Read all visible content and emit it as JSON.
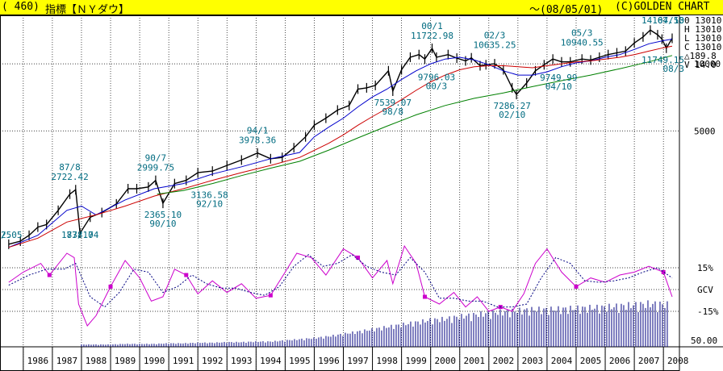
{
  "header": {
    "code": "( 460)",
    "title": "指標【ＮＹダウ】",
    "date_range": "～(08/05/01)",
    "copyright": "(C)GOLDEN CHART"
  },
  "colors": {
    "price": "#000000",
    "ma_short": "#0000cc",
    "ma_mid": "#cc0000",
    "ma_long": "#008000",
    "oscillator": "#cc00cc",
    "oscillator_signal": "#000080",
    "annotation": "#006b80",
    "grid": "#000000",
    "header_bg": "#ffff00"
  },
  "ohlc_panel": {
    "O": "0 13010",
    "H": "H 13010",
    "L": "L 13010",
    "C": "C 13010",
    "change": "△189.8",
    "V": "V  14.0"
  },
  "chart_data": {
    "type": "line",
    "title": "指標【ＮＹダウ】",
    "x_axis": {
      "tick_labels": [
        "1986",
        "1987",
        "1988",
        "1989",
        "1990",
        "1991",
        "1992",
        "1993",
        "1994",
        "1995",
        "1996",
        "1997",
        "1998",
        "1999",
        "2000",
        "2001",
        "2002",
        "2003",
        "2004",
        "2005",
        "2006",
        "2007",
        "2008"
      ]
    },
    "y_axis_price": {
      "scale": "log",
      "tick_labels": [
        "10000",
        "5000"
      ],
      "ticks": [
        10000,
        5000
      ],
      "range": [
        1600,
        16500
      ]
    },
    "y_axis_oscillator": {
      "tick_labels": [
        "15%",
        "GCV",
        "-15%"
      ],
      "ticks": [
        15,
        0,
        -15
      ]
    },
    "y_axis_volume": {
      "tick_labels": [
        "50.00"
      ]
    },
    "series": [
      {
        "key": "price",
        "x": [
          1985.5,
          1985.9,
          1986.2,
          1986.5,
          1986.8,
          1987.2,
          1987.6,
          1987.8,
          1987.95,
          1988.3,
          1988.7,
          1989.2,
          1989.6,
          1989.9,
          1990.3,
          1990.55,
          1990.8,
          1991.2,
          1991.6,
          1992.0,
          1992.5,
          1993.0,
          1993.5,
          1994.05,
          1994.5,
          1994.9,
          1995.3,
          1995.7,
          1996.0,
          1996.4,
          1996.8,
          1997.2,
          1997.5,
          1997.8,
          1998.1,
          1998.55,
          1998.7,
          1999.0,
          1999.3,
          1999.6,
          1999.8,
          2000.05,
          2000.2,
          2000.6,
          2000.9,
          2001.2,
          2001.4,
          2001.7,
          2001.9,
          2002.2,
          2002.5,
          2002.8,
          2002.95,
          2003.3,
          2003.6,
          2003.9,
          2004.2,
          2004.5,
          2004.8,
          2005.2,
          2005.5,
          2005.8,
          2006.1,
          2006.4,
          2006.7,
          2007.0,
          2007.3,
          2007.55,
          2007.8,
          2007.95,
          2008.1,
          2008.3
        ],
        "y": [
          1550,
          1600,
          1700,
          1850,
          1900,
          2200,
          2600,
          2722,
          1738,
          2050,
          2150,
          2350,
          2750,
          2750,
          2800,
          2999,
          2365,
          2900,
          3000,
          3250,
          3300,
          3500,
          3700,
          3978,
          3750,
          3800,
          4200,
          4700,
          5300,
          5700,
          6200,
          6500,
          7700,
          7800,
          8000,
          9300,
          7539,
          9400,
          10700,
          11000,
          10500,
          11722,
          10700,
          11000,
          10600,
          10300,
          10635,
          9800,
          9900,
          10000,
          9400,
          7800,
          7286,
          8200,
          9300,
          9900,
          10500,
          10200,
          10200,
          10500,
          10400,
          10700,
          11000,
          11200,
          11400,
          12400,
          13200,
          14164,
          13500,
          12900,
          11749,
          13010
        ]
      },
      {
        "key": "ma_short",
        "x": [
          1985.5,
          1986.5,
          1987.5,
          1988.0,
          1988.5,
          1989.5,
          1990.5,
          1991.5,
          1992.5,
          1993.5,
          1994.5,
          1995.5,
          1996.0,
          1996.5,
          1997.0,
          1997.5,
          1998.0,
          1998.5,
          1999.0,
          1999.5,
          2000.0,
          2000.5,
          2001.0,
          2001.5,
          2002.0,
          2002.5,
          2003.0,
          2003.5,
          2004.0,
          2004.5,
          2005.0,
          2005.5,
          2006.0,
          2006.5,
          2007.0,
          2007.5,
          2008.0,
          2008.3
        ],
        "y": [
          1500,
          1700,
          2200,
          2300,
          2100,
          2450,
          2750,
          2900,
          3200,
          3450,
          3750,
          4000,
          4700,
          5200,
          5700,
          6400,
          7100,
          7700,
          8500,
          9300,
          10000,
          10500,
          10700,
          10400,
          9900,
          9300,
          8900,
          8900,
          9200,
          9700,
          10100,
          10300,
          10700,
          11000,
          11600,
          12300,
          12700,
          12900
        ]
      },
      {
        "key": "ma_mid",
        "x": [
          1985.5,
          1986.5,
          1987.5,
          1988.5,
          1989.5,
          1990.5,
          1991.5,
          1992.5,
          1993.5,
          1994.5,
          1995.5,
          1996.5,
          1997.0,
          1997.5,
          1998.0,
          1998.5,
          1999.0,
          1999.5,
          2000.0,
          2000.5,
          2001.0,
          2001.5,
          2002.0,
          2002.5,
          2003.0,
          2003.5,
          2004.0,
          2004.5,
          2005.0,
          2005.5,
          2006.0,
          2006.5,
          2007.0,
          2007.5,
          2008.0,
          2008.3
        ],
        "y": [
          1500,
          1650,
          1950,
          2100,
          2300,
          2550,
          2750,
          3000,
          3250,
          3500,
          3800,
          4400,
          4800,
          5300,
          5800,
          6300,
          6900,
          7600,
          8300,
          8900,
          9400,
          9700,
          9800,
          9800,
          9700,
          9600,
          9800,
          10000,
          10200,
          10300,
          10500,
          10700,
          11000,
          11400,
          11800,
          12000
        ]
      },
      {
        "key": "ma_long",
        "x": [
          1990.6,
          1991.5,
          1992.5,
          1993.5,
          1994.5,
          1995.5,
          1996.5,
          1997.5,
          1998.5,
          1999.5,
          2000.5,
          2001.5,
          2002.5,
          2003.5,
          2004.5,
          2005.5,
          2006.5,
          2007.5,
          2008.3
        ],
        "y": [
          2600,
          2700,
          2900,
          3150,
          3400,
          3650,
          4100,
          4650,
          5250,
          5900,
          6500,
          7000,
          7400,
          7900,
          8400,
          8900,
          9500,
          10200,
          10900
        ]
      },
      {
        "key": "oscillator",
        "x": [
          1985.5,
          1986.0,
          1986.6,
          1986.9,
          1987.5,
          1987.75,
          1987.9,
          1988.2,
          1988.5,
          1989.0,
          1989.5,
          1990.0,
          1990.4,
          1990.8,
          1991.2,
          1991.6,
          1992.0,
          1992.5,
          1993.0,
          1993.5,
          1994.0,
          1994.5,
          1995.0,
          1995.4,
          1995.9,
          1996.4,
          1997.0,
          1997.5,
          1998.0,
          1998.5,
          1998.7,
          1999.1,
          1999.5,
          1999.8,
          2000.3,
          2000.8,
          2001.2,
          2001.6,
          2002.0,
          2002.4,
          2002.8,
          2003.2,
          2003.6,
          2004.0,
          2004.5,
          2005.0,
          2005.5,
          2006.0,
          2006.5,
          2007.0,
          2007.5,
          2008.0,
          2008.3
        ],
        "y": [
          5,
          12,
          18,
          10,
          25,
          22,
          -10,
          -25,
          -18,
          2,
          20,
          8,
          -8,
          -5,
          14,
          10,
          -3,
          6,
          -2,
          4,
          -6,
          -4,
          12,
          25,
          22,
          10,
          28,
          22,
          8,
          20,
          4,
          30,
          18,
          -5,
          -10,
          -2,
          -12,
          -5,
          -15,
          -12,
          -15,
          -3,
          18,
          28,
          12,
          2,
          8,
          5,
          10,
          12,
          16,
          12,
          -5
        ]
      },
      {
        "key": "oscillator_signal",
        "x": [
          1985.5,
          1986.2,
          1986.8,
          1987.4,
          1987.8,
          1988.3,
          1988.8,
          1989.3,
          1989.8,
          1990.3,
          1990.8,
          1991.3,
          1991.8,
          1992.3,
          1992.8,
          1993.3,
          1993.8,
          1994.3,
          1994.8,
          1995.3,
          1995.8,
          1996.3,
          1996.8,
          1997.3,
          1997.8,
          1998.3,
          1998.8,
          1999.3,
          1999.8,
          2000.3,
          2000.8,
          2001.3,
          2001.8,
          2002.3,
          2002.8,
          2003.3,
          2003.8,
          2004.3,
          2004.8,
          2005.3,
          2005.8,
          2006.3,
          2006.8,
          2007.3,
          2007.8,
          2008.3
        ],
        "y": [
          3,
          10,
          14,
          14,
          18,
          -5,
          -12,
          -2,
          14,
          12,
          -2,
          2,
          10,
          4,
          1,
          1,
          -2,
          -4,
          2,
          16,
          24,
          16,
          18,
          24,
          16,
          12,
          10,
          22,
          12,
          -6,
          -6,
          -8,
          -8,
          -12,
          -12,
          -10,
          8,
          22,
          18,
          6,
          5,
          6,
          8,
          12,
          15,
          8
        ]
      }
    ],
    "volume": {
      "x": [
        1988.0,
        1988.5,
        1989.0,
        1989.5,
        1990.0,
        1990.5,
        1991.0,
        1991.5,
        1992.0,
        1992.5,
        1993.0,
        1993.5,
        1994.0,
        1994.5,
        1995.0,
        1995.5,
        1996.0,
        1996.5,
        1997.0,
        1997.5,
        1998.0,
        1998.5,
        1999.0,
        1999.5,
        2000.0,
        2000.5,
        2001.0,
        2001.5,
        2002.0,
        2002.5,
        2003.0,
        2003.5,
        2004.0,
        2004.5,
        2005.0,
        2005.5,
        2006.0,
        2006.5,
        2007.0,
        2007.5,
        2008.0,
        2008.2
      ],
      "y": [
        4,
        4,
        4,
        5,
        5,
        5,
        6,
        6,
        7,
        7,
        8,
        8,
        9,
        9,
        11,
        13,
        15,
        18,
        22,
        26,
        30,
        34,
        38,
        42,
        46,
        48,
        52,
        55,
        58,
        60,
        62,
        64,
        64,
        65,
        66,
        67,
        68,
        70,
        72,
        74,
        73,
        72
      ]
    },
    "annotations": [
      {
        "text": "87/8",
        "x": 1987.6,
        "y": 2722,
        "pos": "above"
      },
      {
        "text": "2722.42",
        "x": 1987.6,
        "y": 2722,
        "pos": "above2"
      },
      {
        "text": "1738.74",
        "x": 1987.95,
        "y": 1738,
        "pos": "below"
      },
      {
        "text": "87/10",
        "x": 1987.95,
        "y": 1738,
        "pos": "below2"
      },
      {
        "text": "90/7",
        "x": 1990.55,
        "y": 2999,
        "pos": "above"
      },
      {
        "text": "2999.75",
        "x": 1990.55,
        "y": 2999,
        "pos": "above2"
      },
      {
        "text": "2365.10",
        "x": 1990.8,
        "y": 2365,
        "pos": "below"
      },
      {
        "text": "90/10",
        "x": 1990.8,
        "y": 2365,
        "pos": "below2"
      },
      {
        "text": "94/1",
        "x": 1994.05,
        "y": 3978,
        "pos": "above"
      },
      {
        "text": "3978.36",
        "x": 1994.05,
        "y": 3978,
        "pos": "above2"
      },
      {
        "text": "3136.58",
        "x": 1992.4,
        "y": 2900,
        "pos": "below"
      },
      {
        "text": "92/10",
        "x": 1992.4,
        "y": 2900,
        "pos": "below2"
      },
      {
        "text": "7539.07",
        "x": 1998.7,
        "y": 7539,
        "pos": "below"
      },
      {
        "text": "98/8",
        "x": 1998.7,
        "y": 7539,
        "pos": "below2"
      },
      {
        "text": "00/1",
        "x": 2000.05,
        "y": 11722,
        "pos": "above"
      },
      {
        "text": "11722.98",
        "x": 2000.05,
        "y": 11722,
        "pos": "above2"
      },
      {
        "text": "9796.03",
        "x": 2000.2,
        "y": 9796,
        "pos": "below"
      },
      {
        "text": "00/3",
        "x": 2000.2,
        "y": 9796,
        "pos": "below2"
      },
      {
        "text": "02/3",
        "x": 2002.2,
        "y": 10635,
        "pos": "above"
      },
      {
        "text": "10635.25",
        "x": 2002.2,
        "y": 10635,
        "pos": "above2"
      },
      {
        "text": "7286.27",
        "x": 2002.8,
        "y": 7286,
        "pos": "below"
      },
      {
        "text": "02/10",
        "x": 2002.8,
        "y": 7286,
        "pos": "below2"
      },
      {
        "text": "9749.99",
        "x": 2004.4,
        "y": 9749,
        "pos": "below"
      },
      {
        "text": "04/10",
        "x": 2004.4,
        "y": 9749,
        "pos": "below2"
      },
      {
        "text": "05/3",
        "x": 2005.2,
        "y": 10940,
        "pos": "above"
      },
      {
        "text": "10940.55",
        "x": 2005.2,
        "y": 10940,
        "pos": "above2"
      },
      {
        "text": "07/10",
        "x": 2007.55,
        "y": 14164,
        "pos": "above"
      },
      {
        "text": "14164.53",
        "x": 2007.55,
        "y": 14164,
        "pos": "above2"
      },
      {
        "text": "11749.15",
        "x": 2008.1,
        "y": 11749,
        "pos": "below"
      },
      {
        "text": "08/3",
        "x": 2008.1,
        "y": 11749,
        "pos": "below2"
      },
      {
        "text": "2.05",
        "x": 1985.5,
        "y": 1550,
        "pos": "below"
      },
      {
        "text": "/5",
        "x": 1985.5,
        "y": 1550,
        "pos": "below2"
      }
    ]
  }
}
